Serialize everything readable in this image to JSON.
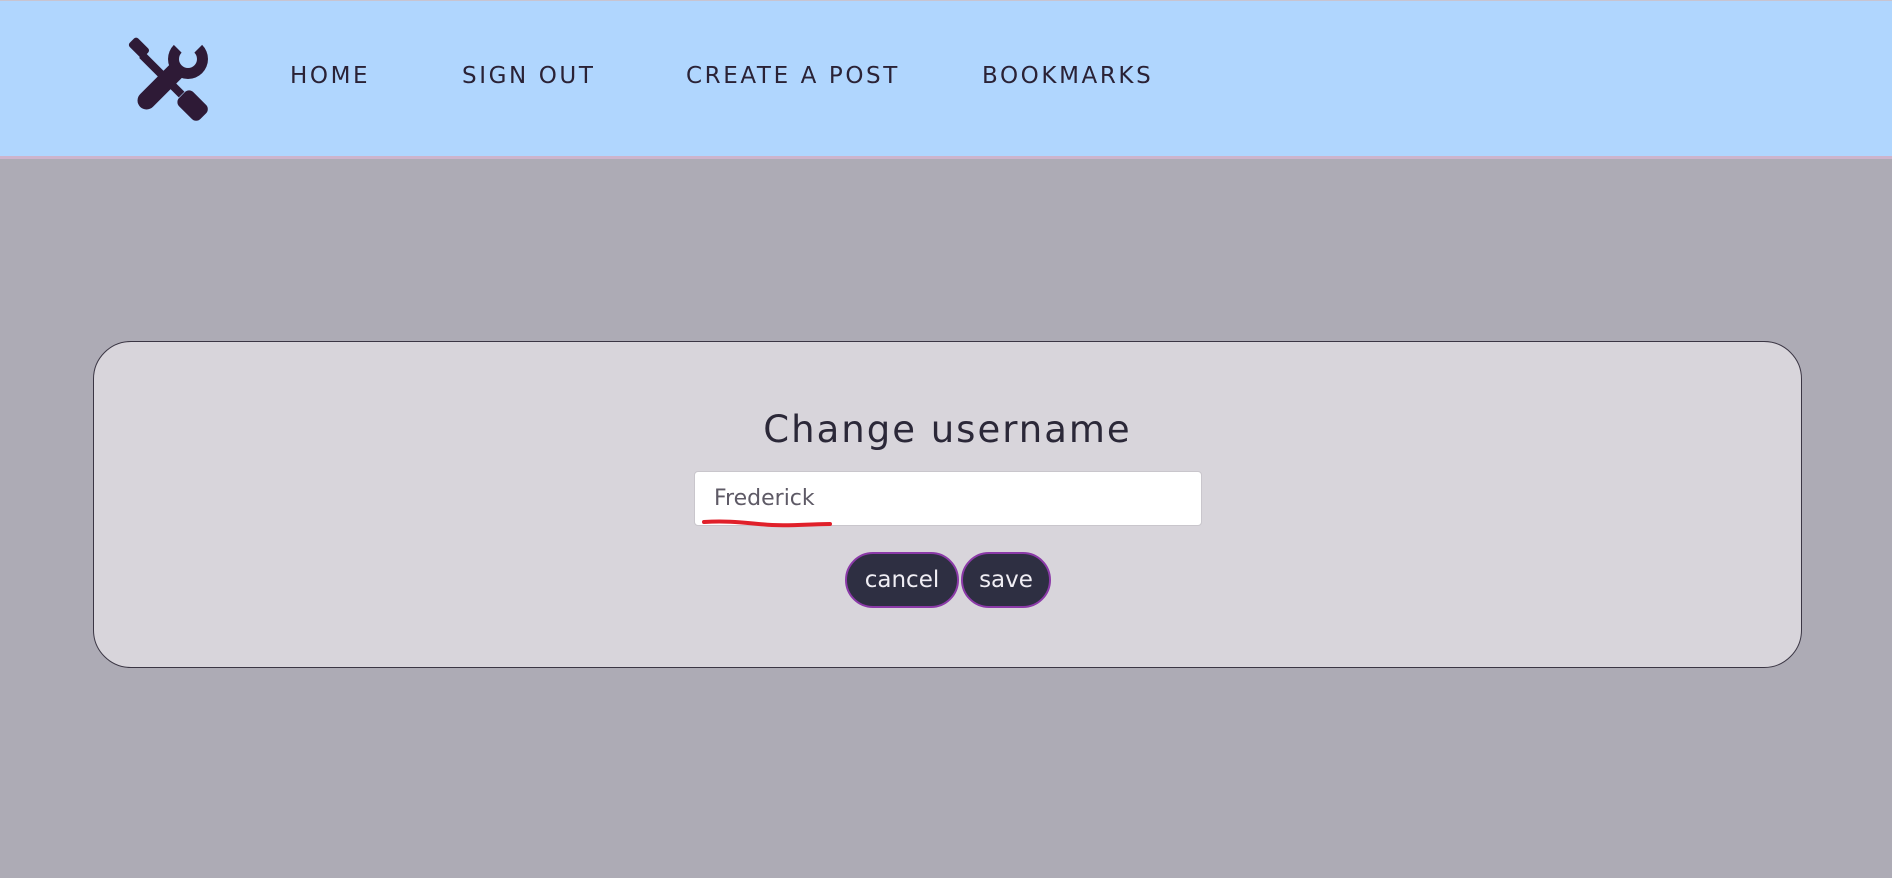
{
  "nav": {
    "logo_icon": "tools-wrench-screwdriver-icon",
    "items": [
      {
        "label": "HOME"
      },
      {
        "label": "SIGN OUT"
      },
      {
        "label": "CREATE A POST"
      },
      {
        "label": "BOOKMARKS"
      }
    ]
  },
  "form": {
    "title": "Change username",
    "username_value": "Frederick",
    "cancel_label": "cancel",
    "save_label": "save"
  },
  "colors": {
    "header_bg": "#b0d6fe",
    "page_bg": "#adabb5",
    "panel_bg": "#d8d5db",
    "button_bg": "#2e2f42",
    "button_border": "#8b3aa8",
    "annotation_underline": "#e0202a"
  }
}
